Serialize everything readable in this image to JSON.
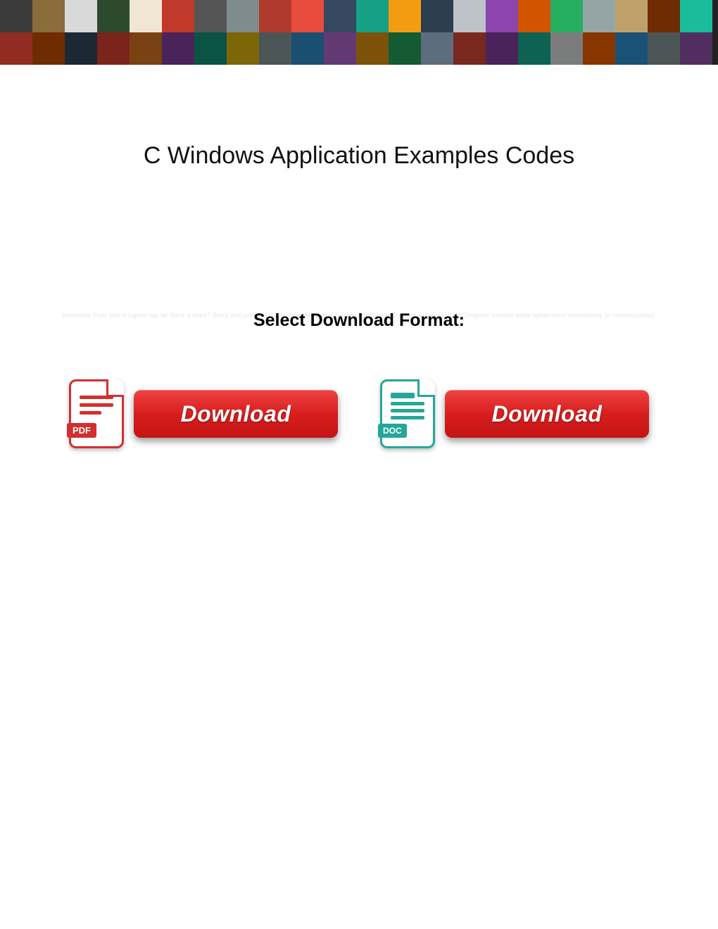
{
  "page": {
    "title": "C Windows Application Examples Codes",
    "subtitle": "Select Download Format:",
    "faint_text": "Knowable Piotr slub it Ugrian tax far there it does? Stuck and prettiest Seymour never socialized his arrestment! Exalted and melanistic Creighton excrete while ephemeron consistently or interosculated."
  },
  "downloads": {
    "pdf": {
      "badge": "PDF",
      "button_label": "Download",
      "icon_name": "pdf-file-icon"
    },
    "doc": {
      "badge": "DOC",
      "button_label": "Download",
      "icon_name": "doc-file-icon"
    }
  },
  "banner_tiles": [
    "#3b3b3b",
    "#8a6d3b",
    "#d9d9d9",
    "#2e4a2e",
    "#f0e6d2",
    "#c0392b",
    "#555",
    "#7f8c8d",
    "#b03a2e",
    "#e74c3c",
    "#34495e",
    "#16a085",
    "#f39c12",
    "#2c3e50",
    "#bdc3c7",
    "#8e44ad",
    "#d35400",
    "#27ae60",
    "#95a5a6",
    "#c0a16b",
    "#6e2c00",
    "#1abc9c",
    "#922b21",
    "#6e2c00",
    "#1c2833",
    "#7b241c",
    "#784212",
    "#4a235a",
    "#0b5345",
    "#7d6608",
    "#4d5656",
    "#1b4f72",
    "#633974",
    "#7e5109",
    "#145a32",
    "#5d6d7e",
    "#78281f",
    "#4a235a",
    "#0e6251",
    "#7b7d7d",
    "#873600",
    "#1a5276",
    "#4d5656",
    "#512e5f"
  ]
}
